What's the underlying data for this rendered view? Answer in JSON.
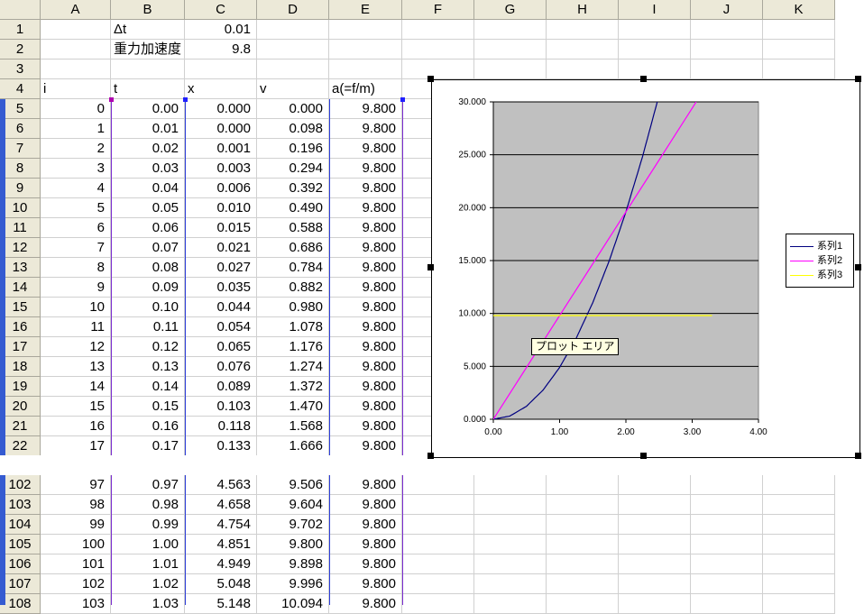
{
  "columns": [
    "A",
    "B",
    "C",
    "D",
    "E",
    "F",
    "G",
    "H",
    "I",
    "J",
    "K"
  ],
  "rows_top": [
    {
      "n": "1",
      "cells": [
        "",
        "Δt",
        "0.01",
        "",
        ""
      ]
    },
    {
      "n": "2",
      "cells": [
        "",
        "重力加速度",
        "9.8",
        "",
        ""
      ]
    },
    {
      "n": "3",
      "cells": [
        "",
        "",
        "",
        "",
        ""
      ]
    },
    {
      "n": "4",
      "cells": [
        "i",
        "t",
        "x",
        "v",
        "a(=f/m)"
      ]
    },
    {
      "n": "5",
      "cells": [
        "0",
        "0.00",
        "0.000",
        "0.000",
        "9.800"
      ]
    },
    {
      "n": "6",
      "cells": [
        "1",
        "0.01",
        "0.000",
        "0.098",
        "9.800"
      ]
    },
    {
      "n": "7",
      "cells": [
        "2",
        "0.02",
        "0.001",
        "0.196",
        "9.800"
      ]
    },
    {
      "n": "8",
      "cells": [
        "3",
        "0.03",
        "0.003",
        "0.294",
        "9.800"
      ]
    },
    {
      "n": "9",
      "cells": [
        "4",
        "0.04",
        "0.006",
        "0.392",
        "9.800"
      ]
    },
    {
      "n": "10",
      "cells": [
        "5",
        "0.05",
        "0.010",
        "0.490",
        "9.800"
      ]
    },
    {
      "n": "11",
      "cells": [
        "6",
        "0.06",
        "0.015",
        "0.588",
        "9.800"
      ]
    },
    {
      "n": "12",
      "cells": [
        "7",
        "0.07",
        "0.021",
        "0.686",
        "9.800"
      ]
    },
    {
      "n": "13",
      "cells": [
        "8",
        "0.08",
        "0.027",
        "0.784",
        "9.800"
      ]
    },
    {
      "n": "14",
      "cells": [
        "9",
        "0.09",
        "0.035",
        "0.882",
        "9.800"
      ]
    },
    {
      "n": "15",
      "cells": [
        "10",
        "0.10",
        "0.044",
        "0.980",
        "9.800"
      ]
    },
    {
      "n": "16",
      "cells": [
        "11",
        "0.11",
        "0.054",
        "1.078",
        "9.800"
      ]
    },
    {
      "n": "17",
      "cells": [
        "12",
        "0.12",
        "0.065",
        "1.176",
        "9.800"
      ]
    },
    {
      "n": "18",
      "cells": [
        "13",
        "0.13",
        "0.076",
        "1.274",
        "9.800"
      ]
    },
    {
      "n": "19",
      "cells": [
        "14",
        "0.14",
        "0.089",
        "1.372",
        "9.800"
      ]
    },
    {
      "n": "20",
      "cells": [
        "15",
        "0.15",
        "0.103",
        "1.470",
        "9.800"
      ]
    },
    {
      "n": "21",
      "cells": [
        "16",
        "0.16",
        "0.118",
        "1.568",
        "9.800"
      ]
    },
    {
      "n": "22",
      "cells": [
        "17",
        "0.17",
        "0.133",
        "1.666",
        "9.800"
      ]
    }
  ],
  "rows_bottom": [
    {
      "n": "102",
      "cells": [
        "97",
        "0.97",
        "4.563",
        "9.506",
        "9.800"
      ]
    },
    {
      "n": "103",
      "cells": [
        "98",
        "0.98",
        "4.658",
        "9.604",
        "9.800"
      ]
    },
    {
      "n": "104",
      "cells": [
        "99",
        "0.99",
        "4.754",
        "9.702",
        "9.800"
      ]
    },
    {
      "n": "105",
      "cells": [
        "100",
        "1.00",
        "4.851",
        "9.800",
        "9.800"
      ]
    },
    {
      "n": "106",
      "cells": [
        "101",
        "1.01",
        "4.949",
        "9.898",
        "9.800"
      ]
    },
    {
      "n": "107",
      "cells": [
        "102",
        "1.02",
        "5.048",
        "9.996",
        "9.800"
      ]
    },
    {
      "n": "108",
      "cells": [
        "103",
        "1.03",
        "5.148",
        "10.094",
        "9.800"
      ]
    }
  ],
  "tooltip": "プロット エリア",
  "colors": {
    "series1": "#000080",
    "series2": "#ff00ff",
    "series3": "#ffff00",
    "plot_bg": "#c0c0c0"
  },
  "chart_data": {
    "type": "scatter",
    "title": "",
    "xlabel": "",
    "ylabel": "",
    "xlim": [
      0,
      4
    ],
    "ylim": [
      0,
      30
    ],
    "x_ticks": [
      "0.00",
      "1.00",
      "2.00",
      "3.00",
      "4.00"
    ],
    "y_ticks": [
      "0.000",
      "5.000",
      "10.000",
      "15.000",
      "20.000",
      "25.000",
      "30.000"
    ],
    "grid": true,
    "legend": "right",
    "series": [
      {
        "name": "系列1",
        "x": [
          0,
          0.25,
          0.5,
          0.75,
          1.0,
          1.25,
          1.5,
          1.75,
          2.0,
          2.25,
          2.5,
          2.47
        ],
        "y": [
          0,
          0.306,
          1.225,
          2.756,
          4.9,
          7.656,
          11.025,
          15.006,
          19.6,
          24.806,
          30.625,
          30
        ]
      },
      {
        "name": "系列2",
        "x": [
          0,
          0.5,
          1.0,
          1.5,
          2.0,
          2.5,
          3.0,
          3.06
        ],
        "y": [
          0,
          4.9,
          9.8,
          14.7,
          19.6,
          24.5,
          29.4,
          30
        ]
      },
      {
        "name": "系列3",
        "x": [
          0,
          3.3
        ],
        "y": [
          9.8,
          9.8
        ]
      }
    ]
  }
}
